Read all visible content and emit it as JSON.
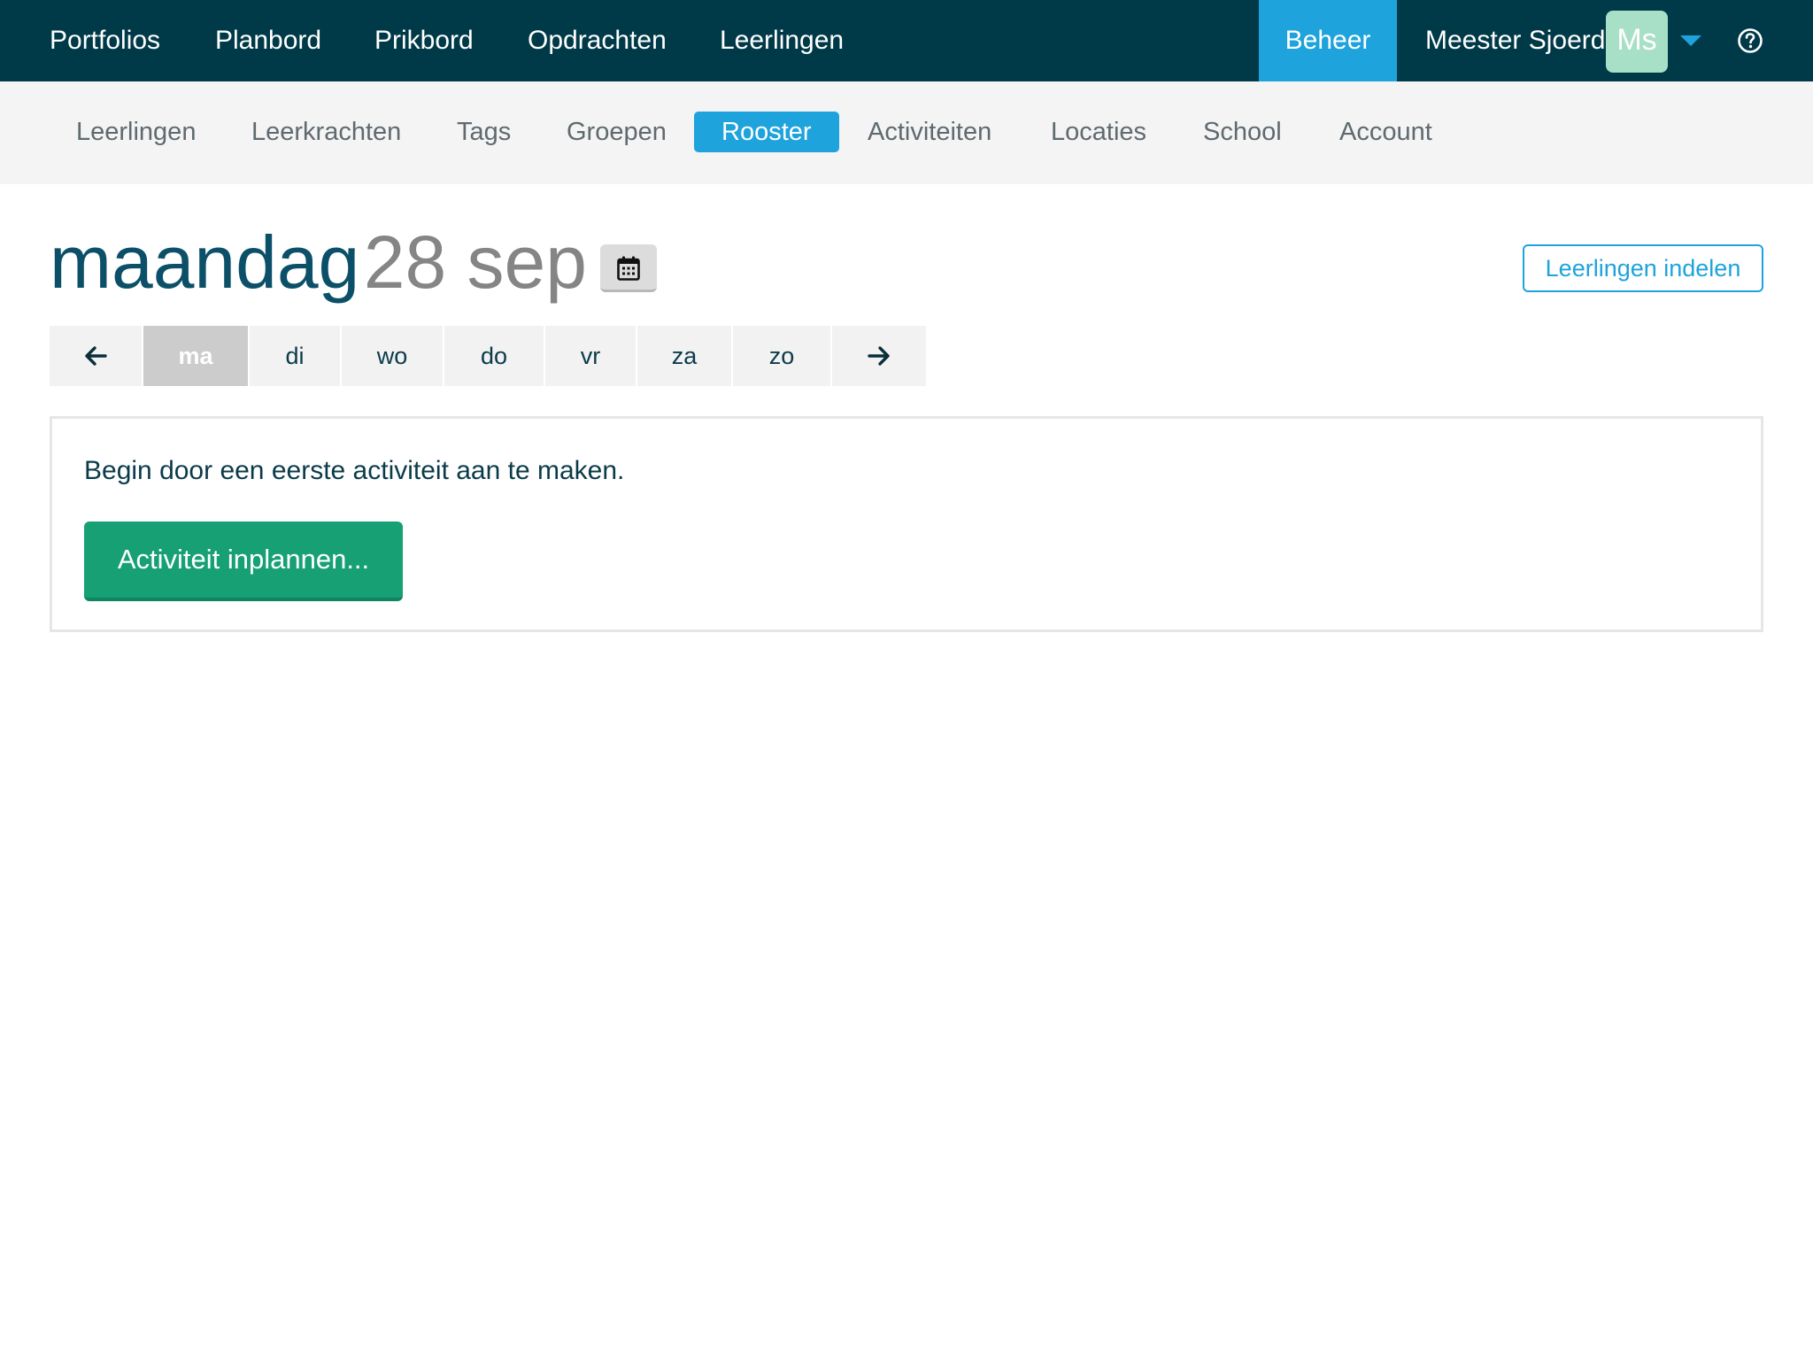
{
  "topnav": {
    "items": [
      "Portfolios",
      "Planbord",
      "Prikbord",
      "Opdrachten",
      "Leerlingen"
    ],
    "active_label": "Beheer",
    "user_name": "Meester Sjoerd",
    "avatar_initials": "Ms"
  },
  "subnav": {
    "items": [
      "Leerlingen",
      "Leerkrachten",
      "Tags",
      "Groepen",
      "Rooster",
      "Activiteiten",
      "Locaties",
      "School",
      "Account"
    ],
    "active_index": 4
  },
  "header": {
    "day": "maandag",
    "date": "28 sep",
    "assign_button": "Leerlingen indelen"
  },
  "days": {
    "labels": [
      "ma",
      "di",
      "wo",
      "do",
      "vr",
      "za",
      "zo"
    ],
    "active_index": 0
  },
  "panel": {
    "message": "Begin door een eerste activiteit aan te maken.",
    "button": "Activiteit inplannen..."
  },
  "colors": {
    "topbar": "#003a48",
    "accent": "#1ea3dc",
    "primary_button": "#16a074",
    "title": "#0b5068"
  },
  "icons": {
    "calendar": "calendar-icon",
    "help": "help-circle-icon",
    "prev": "arrow-left-icon",
    "next": "arrow-right-icon"
  }
}
